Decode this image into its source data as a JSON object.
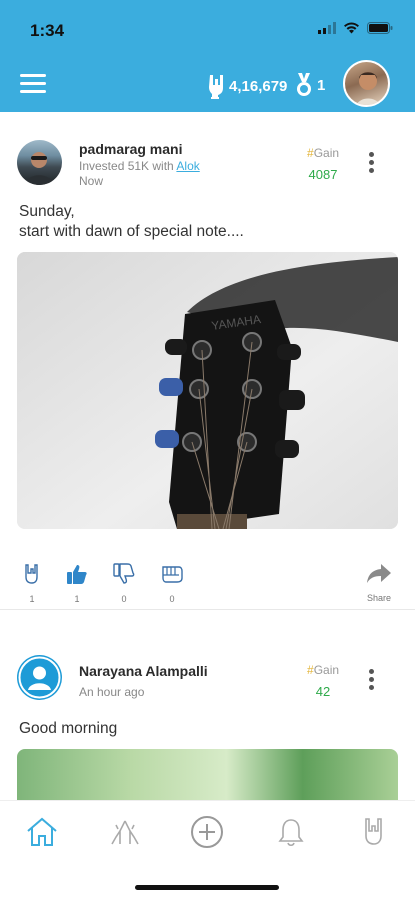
{
  "status_bar": {
    "time": "1:34"
  },
  "header": {
    "coins": "4,16,679",
    "medals": "1"
  },
  "posts": [
    {
      "author": "padmarag mani",
      "invested_prefix": "Invested 51K with ",
      "invested_with": "Alok",
      "time": "Now",
      "gain_label": "Gain",
      "gain_value": "4087",
      "text_line1": "Sunday,",
      "text_line2": "start with dawn of special note....",
      "image_brand": "YAMAHA",
      "reactions": {
        "rock": "1",
        "like": "1",
        "dislike": "0",
        "punch": "0"
      },
      "share_label": "Share"
    },
    {
      "author": "Narayana Alampalli",
      "time": "An hour ago",
      "gain_label": "Gain",
      "gain_value": "42",
      "text": "Good morning"
    }
  ],
  "colors": {
    "brand": "#3badde",
    "gain": "#2eaa4a",
    "link": "#3badde"
  },
  "icons": {
    "tabs": [
      "home-icon",
      "praying-hands-icon",
      "add-circle-icon",
      "bell-icon",
      "rock-hand-icon"
    ]
  }
}
